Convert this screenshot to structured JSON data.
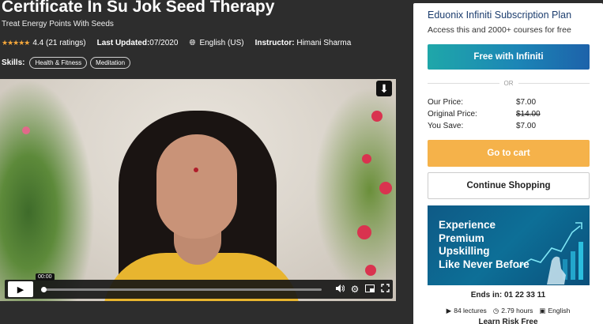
{
  "course": {
    "title": "Certificate In Su Jok Seed Therapy",
    "subtitle": "Treat Energy Points With Seeds",
    "rating_stars": "★★★★★",
    "rating_text": "4.4 (21 ratings)",
    "last_updated_label": "Last Updated:",
    "last_updated_value": "07/2020",
    "language": "English (US)",
    "instructor_label": "Instructor:",
    "instructor_name": "Himani Sharma",
    "skills_label": "Skills:",
    "skills": [
      "Health & Fitness",
      "Meditation"
    ]
  },
  "video": {
    "current_time": "00:00",
    "progress": 0
  },
  "panel": {
    "plan_title": "Eduonix Infiniti Subscription Plan",
    "plan_subtitle": "Access this and 2000+ courses for free",
    "infiniti_button": "Free with Infiniti",
    "or_text": "OR",
    "our_price_label": "Our Price:",
    "our_price": "$7.00",
    "original_price_label": "Original Price:",
    "original_price": "$14.00",
    "you_save_label": "You Save:",
    "you_save": "$7.00",
    "cart_button": "Go to cart",
    "shop_button": "Continue Shopping",
    "banner_line1": "Experience",
    "banner_line2": "Premium",
    "banner_line3": "Upskilling",
    "banner_line4": "Like Never Before",
    "ends_in": "Ends in: 01 22 33 11",
    "lectures": "84 lectures",
    "hours": "2.79 hours",
    "language": "English",
    "learn_risk_free": "Learn Risk Free"
  },
  "colors": {
    "accent_orange": "#f5b24a",
    "star": "#f4a73b",
    "plan_title": "#1c3d6e",
    "infiniti_gradient_start": "#1fa7a9",
    "infiniti_gradient_end": "#1d62aa"
  }
}
